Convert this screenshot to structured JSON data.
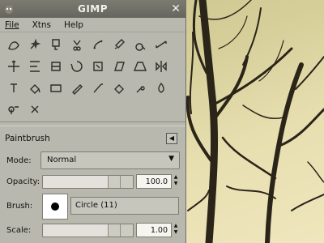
{
  "window": {
    "title": "GIMP"
  },
  "menu": {
    "items": [
      "File",
      "Xtns",
      "Help"
    ]
  },
  "tools": [
    "free-select-icon",
    "fuzzy-select-icon",
    "color-select-icon",
    "scissors-icon",
    "paths-icon",
    "color-picker-icon",
    "zoom-icon",
    "measure-icon",
    "move-icon",
    "align-icon",
    "crop-icon",
    "rotate-icon",
    "scale-icon",
    "shear-icon",
    "perspective-icon",
    "flip-icon",
    "text-icon",
    "bucket-fill-icon",
    "blend-icon",
    "pencil-icon",
    "paintbrush-icon",
    "eraser-icon",
    "airbrush-icon",
    "ink-icon",
    "clone-icon",
    "heal-icon"
  ],
  "panel": {
    "title": "Paintbrush",
    "mode_label": "Mode:",
    "mode_value": "Normal",
    "opacity_label": "Opacity:",
    "opacity_value": "100.0",
    "opacity_fraction": 1.0,
    "brush_label": "Brush:",
    "brush_value": "Circle (11)",
    "scale_label": "Scale:",
    "scale_value": "1.00",
    "scale_fraction": 0.8
  }
}
